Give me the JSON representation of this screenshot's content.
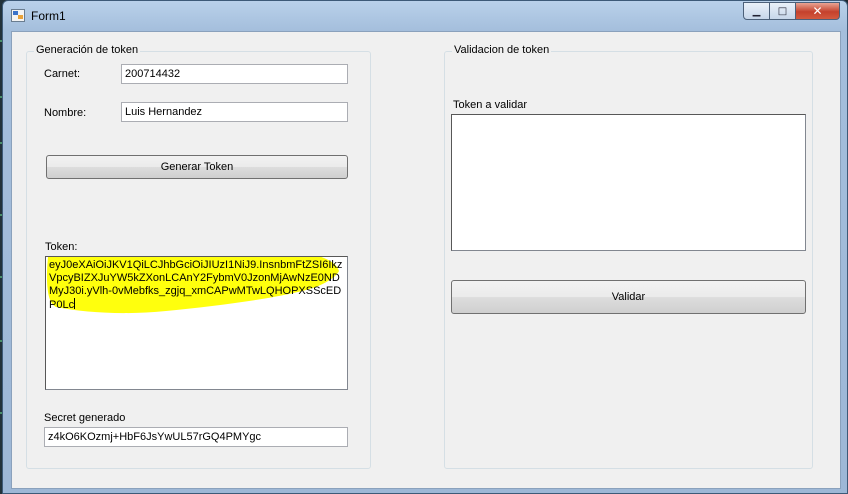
{
  "window": {
    "title": "Form1",
    "minimize_glyph": "▁",
    "maximize_glyph": "□",
    "close_glyph": "✕"
  },
  "generation": {
    "legend": "Generación de token",
    "carnet_label": "Carnet:",
    "carnet_value": "200714432",
    "nombre_label": "Nombre:",
    "nombre_value": "Luis Hernandez",
    "generate_button": "Generar Token",
    "token_label": "Token:",
    "token_value": "eyJ0eXAiOiJKV1QiLCJhbGciOiJIUzI1NiJ9.InsnbmFtZSI6IkzVpcyBIZXJuYW5kZXonLCAnY2FybmV0JzonMjAwNzE0NDMyJ30i.yVlh-0vMebfks_zgjq_xmCAPwMTwLQHOPXSScEDP0Lc",
    "secret_label": "Secret generado",
    "secret_value": "z4kO6KOzmj+HbF6JsYwUL57rGQ4PMYgc",
    "highlight_color": "#ffff00"
  },
  "validation": {
    "legend": "Validacion de token",
    "token_label": "Token a validar",
    "token_value": "",
    "validate_button": "Validar"
  }
}
